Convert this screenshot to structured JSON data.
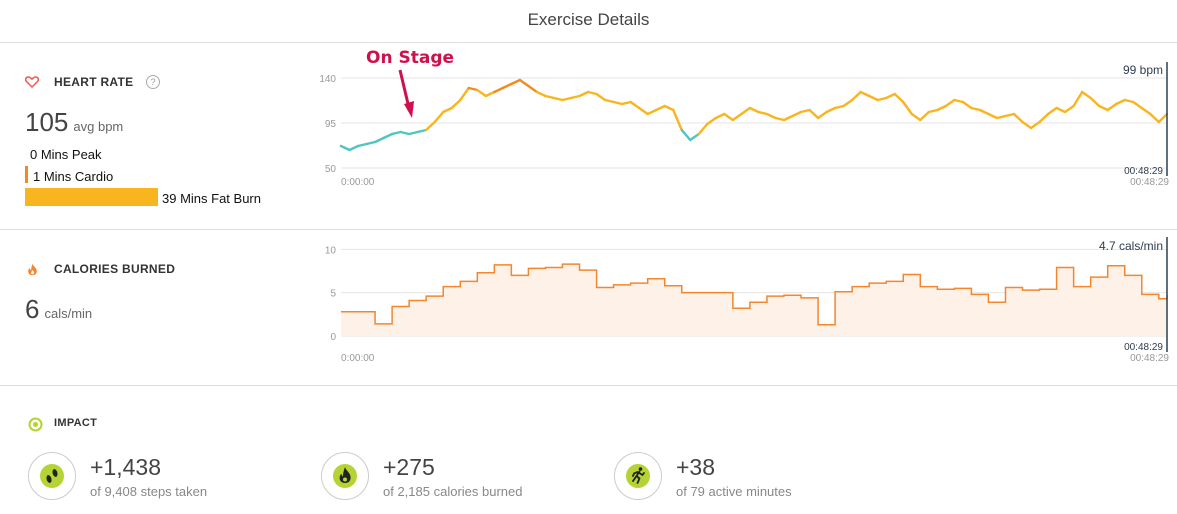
{
  "page_title": "Exercise Details",
  "annotation": {
    "text": "On Stage",
    "color": "#d0104c"
  },
  "heart_rate": {
    "label": "HEART RATE",
    "help": "?",
    "avg_value": "105",
    "avg_unit": "avg bpm",
    "zones": [
      {
        "label": "0 Mins Peak",
        "minutes": 0
      },
      {
        "label": "1 Mins Cardio",
        "minutes": 1
      },
      {
        "label": "39 Mins Fat Burn",
        "minutes": 39
      }
    ]
  },
  "calories": {
    "label": "CALORIES BURNED",
    "value": "6",
    "unit": "cals/min"
  },
  "impact": {
    "label": "IMPACT",
    "items": [
      {
        "value": "+1,438",
        "sub": "of 9,408 steps taken",
        "icon": "footprints-icon"
      },
      {
        "value": "+275",
        "sub": "of 2,185 calories burned",
        "icon": "flame-icon"
      },
      {
        "value": "+38",
        "sub": "of 79 active minutes",
        "icon": "running-person-icon"
      }
    ]
  },
  "colors": {
    "fat_burn": "#f9b51f",
    "cardio": "#f28b1e",
    "below_zone": "#4ec5c1",
    "calories_line": "#f4862e",
    "calories_fill": "#fdf1e8",
    "accent_icon": "#b5d334"
  },
  "chart_data": [
    {
      "type": "line",
      "name": "heart-rate",
      "x_range": [
        0,
        48.48
      ],
      "y_ticks": [
        50,
        95,
        140
      ],
      "ylim": [
        42,
        156
      ],
      "x_tick_labels": [
        "0:00:00",
        "00:48:29"
      ],
      "cursor_label_top": "99 bpm",
      "cursor_label_bottom": "00:48:29",
      "x": [
        0,
        0.5,
        1,
        1.5,
        2,
        2.5,
        3,
        3.5,
        4,
        4.5,
        5,
        5.5,
        6,
        6.5,
        7,
        7.5,
        8,
        8.5,
        9,
        9.5,
        10,
        10.5,
        11,
        11.5,
        12,
        12.5,
        13,
        13.5,
        14,
        14.5,
        15,
        15.5,
        16,
        16.5,
        17,
        17.5,
        18,
        18.5,
        19,
        19.5,
        20,
        20.5,
        21,
        21.5,
        22,
        22.5,
        23,
        23.5,
        24,
        24.5,
        25,
        25.5,
        26,
        26.5,
        27,
        27.5,
        28,
        28.5,
        29,
        29.5,
        30,
        30.5,
        31,
        31.5,
        32,
        32.5,
        33,
        33.5,
        34,
        34.5,
        35,
        35.5,
        36,
        36.5,
        37,
        37.5,
        38,
        38.5,
        39,
        39.5,
        40,
        40.5,
        41,
        41.5,
        42,
        42.5,
        43,
        43.5,
        44,
        44.5,
        45,
        45.5,
        46,
        46.5,
        47,
        47.5,
        48,
        48.48
      ],
      "y": [
        72,
        68,
        72,
        74,
        76,
        80,
        84,
        86,
        84,
        86,
        88,
        96,
        106,
        110,
        118,
        130,
        128,
        122,
        126,
        130,
        134,
        138,
        132,
        126,
        122,
        120,
        118,
        120,
        122,
        126,
        124,
        118,
        116,
        114,
        116,
        110,
        104,
        108,
        112,
        108,
        88,
        78,
        84,
        94,
        100,
        104,
        98,
        104,
        110,
        106,
        104,
        100,
        98,
        102,
        106,
        108,
        100,
        106,
        110,
        112,
        118,
        126,
        122,
        118,
        120,
        124,
        116,
        104,
        98,
        106,
        108,
        112,
        118,
        116,
        110,
        108,
        104,
        100,
        102,
        104,
        96,
        90,
        96,
        104,
        110,
        106,
        112,
        126,
        120,
        112,
        108,
        114,
        118,
        116,
        110,
        104,
        96,
        104
      ]
    },
    {
      "type": "area",
      "name": "calories",
      "x_range": [
        0,
        48.48
      ],
      "y_ticks": [
        0,
        5,
        10
      ],
      "ylim": [
        0,
        10.5
      ],
      "x_tick_labels": [
        "0:00:00",
        "00:48:29"
      ],
      "cursor_label_top": "4.7 cals/min",
      "cursor_label_bottom": "00:48:29",
      "x": [
        0,
        1,
        2,
        3,
        4,
        5,
        6,
        7,
        8,
        9,
        10,
        11,
        12,
        13,
        14,
        15,
        16,
        17,
        18,
        19,
        20,
        21,
        22,
        23,
        24,
        25,
        26,
        27,
        28,
        29,
        30,
        31,
        32,
        33,
        34,
        35,
        36,
        37,
        38,
        39,
        40,
        41,
        42,
        43,
        44,
        45,
        46,
        47,
        48,
        48.48
      ],
      "y": [
        2.8,
        2.8,
        1.4,
        3.4,
        4.1,
        4.6,
        5.7,
        6.3,
        7.3,
        8.2,
        7.0,
        7.8,
        7.9,
        8.3,
        7.6,
        5.6,
        5.9,
        6.1,
        6.6,
        5.8,
        5.0,
        5.0,
        5.0,
        3.2,
        3.9,
        4.6,
        4.7,
        4.4,
        1.3,
        5.1,
        5.7,
        6.1,
        6.3,
        7.1,
        5.7,
        5.4,
        5.5,
        4.8,
        3.9,
        5.6,
        5.3,
        5.4,
        7.9,
        5.7,
        6.8,
        8.1,
        7.0,
        4.8,
        4.3,
        4.7
      ]
    }
  ]
}
